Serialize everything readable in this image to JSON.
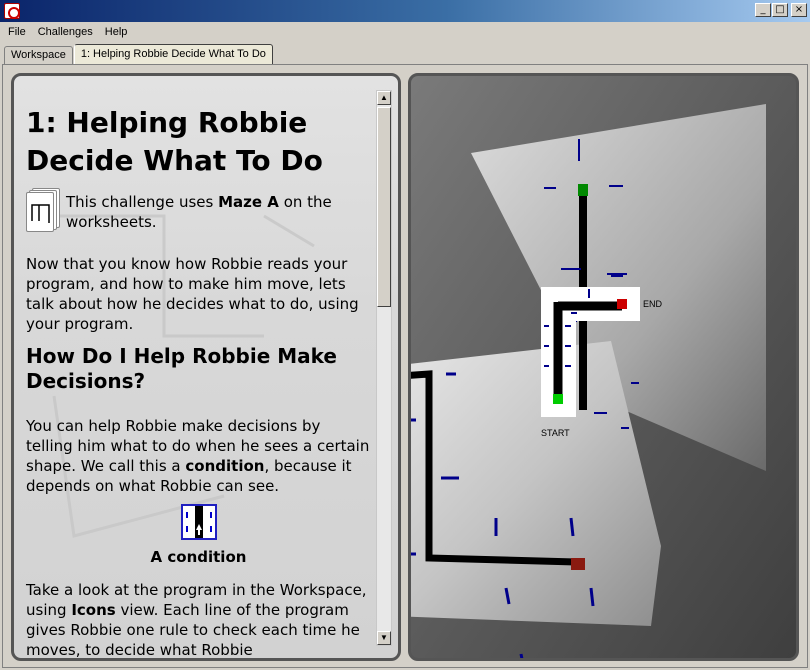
{
  "window": {
    "minimize_glyph": "_",
    "maximize_glyph": "□",
    "close_glyph": "×"
  },
  "menu": {
    "file": "File",
    "challenges": "Challenges",
    "help": "Help"
  },
  "tabs": [
    {
      "label": "Workspace"
    },
    {
      "label": "1: Helping Robbie Decide What To Do"
    }
  ],
  "instructions": {
    "title": "1: Helping Robbie Decide What To Do",
    "maze_intro": "This challenge uses",
    "maze_name": "Maze A",
    "maze_outro": "on the worksheets.",
    "para1": "Now that you know how Robbie reads your program, and how to make him move, lets talk about how he decides what to do, using your program.",
    "heading2": "How Do I Help Robbie Make Decisions?",
    "para2_a": "You can help Robbie make decisions by telling him what to do when he sees a certain shape. We call this a",
    "para2_bold": "condition",
    "para2_b": ", because it depends on what Robbie can see.",
    "condition_caption": "A condition",
    "para3_a": "Take a look at the program in the Workspace, using",
    "para3_bold": "Icons",
    "para3_b": "view. Each line of the program gives Robbie one rule to check each time he moves, to decide what Robbie"
  },
  "world": {
    "end_label": "END",
    "start_label": "START"
  },
  "colors": {
    "titlebar_start": "#0a246a",
    "start_marker": "#00cc00",
    "end_marker": "#cc0000",
    "end_of_track": "#8a1a10"
  }
}
